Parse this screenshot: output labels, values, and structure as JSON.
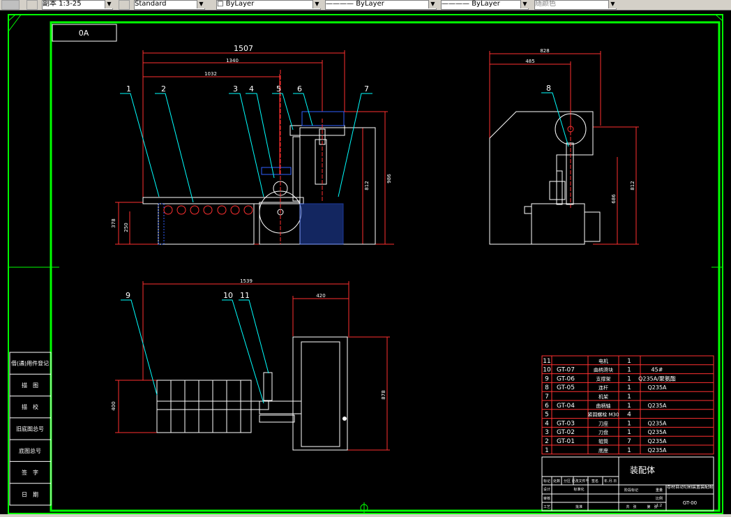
{
  "toolbar": {
    "scale_label": "副本 1:3-25",
    "text_style": "Standard",
    "layer": "ByLayer",
    "linetype": "ByLayer",
    "lineweight": "ByLayer",
    "color": "随颜色"
  },
  "drawing": {
    "sheet_label": "0A",
    "front_view": {
      "dims": {
        "d1507": "1507",
        "d1340": "1340",
        "d1032": "1032",
        "d812": "812",
        "d986": "986",
        "d378": "378",
        "d250": "250"
      },
      "callouts": [
        "1",
        "2",
        "3",
        "4",
        "5",
        "6",
        "7"
      ]
    },
    "side_view": {
      "dims": {
        "d828": "828",
        "d485": "485",
        "d812": "812",
        "d686": "686"
      },
      "callouts": [
        "8"
      ]
    },
    "top_view": {
      "dims": {
        "d1539": "1539",
        "d420": "420",
        "d400": "400",
        "d878": "878"
      },
      "callouts": [
        "9",
        "10",
        "11"
      ]
    },
    "left_stamps": [
      "借(通)用件登记",
      "描　图",
      "描　校",
      "旧底图总号",
      "底图总号",
      "签　字",
      "日　期"
    ],
    "bom": [
      {
        "no": "11",
        "code": "",
        "name": "电机",
        "qty": "1",
        "material": ""
      },
      {
        "no": "10",
        "code": "GT-07",
        "name": "曲柄滑块",
        "qty": "1",
        "material": "45#"
      },
      {
        "no": "9",
        "code": "GT-06",
        "name": "支撑架",
        "qty": "1",
        "material": "Q235A/聚氨酯"
      },
      {
        "no": "8",
        "code": "GT-05",
        "name": "连杆",
        "qty": "1",
        "material": "Q235A"
      },
      {
        "no": "7",
        "code": "",
        "name": "机架",
        "qty": "1",
        "material": ""
      },
      {
        "no": "6",
        "code": "GT-04",
        "name": "曲柄轴",
        "qty": "1",
        "material": "Q235A"
      },
      {
        "no": "5",
        "code": "",
        "name": "紧固螺栓 M30",
        "qty": "4",
        "material": ""
      },
      {
        "no": "4",
        "code": "GT-03",
        "name": "刀座",
        "qty": "1",
        "material": "Q235A"
      },
      {
        "no": "3",
        "code": "GT-02",
        "name": "刀盘",
        "qty": "1",
        "material": "Q235A"
      },
      {
        "no": "2",
        "code": "GT-01",
        "name": "辊筒",
        "qty": "7",
        "material": "Q235A"
      },
      {
        "no": "1",
        "code": "",
        "name": "底座",
        "qty": "1",
        "material": "Q235A"
      }
    ],
    "title_block": {
      "assembly_name": "装配体",
      "design_title": "卷材自动切割装置装配图",
      "drawing_no": "GT-00",
      "scale": "1:2",
      "header_cells": [
        "标记",
        "处数",
        "分区",
        "更改文件号",
        "签名",
        "年.月.日"
      ],
      "role_1": "设计",
      "role_2": "标准化",
      "stage_label": "阶段标记",
      "weight_label": "重量",
      "scale_label": "比例",
      "sheet_count_label": "共　张",
      "sheet_label": "第　张",
      "review_label": "审核",
      "process_label": "工艺",
      "approve_label": "批准"
    }
  }
}
